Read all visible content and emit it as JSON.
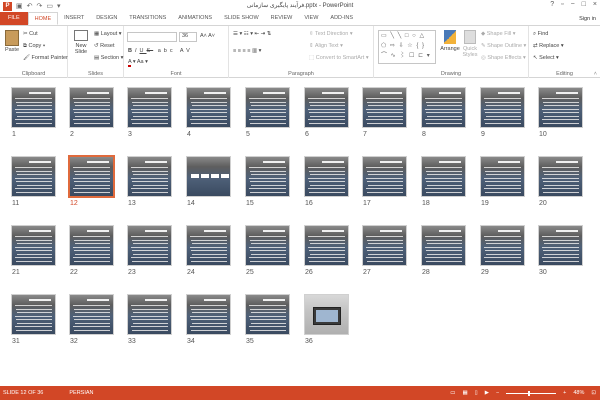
{
  "window": {
    "title": "فرآیند پایگیری سازمانی.pptx - PowerPoint",
    "app_icon": "P",
    "sign_in": "Sign in"
  },
  "tabs": [
    "FILE",
    "HOME",
    "INSERT",
    "DESIGN",
    "TRANSITIONS",
    "ANIMATIONS",
    "SLIDE SHOW",
    "REVIEW",
    "VIEW",
    "ADD-INS"
  ],
  "ribbon": {
    "clipboard": {
      "label": "Clipboard",
      "paste": "Paste",
      "cut": "Cut",
      "copy": "Copy",
      "format_painter": "Format Painter"
    },
    "slides": {
      "label": "Slides",
      "new_slide": "New Slide",
      "layout": "Layout",
      "reset": "Reset",
      "section": "Section"
    },
    "font": {
      "label": "Font",
      "size": "36",
      "bold": "B",
      "italic": "I",
      "underline": "U",
      "strike": "S",
      "abc": "abc",
      "av": "AV"
    },
    "paragraph": {
      "label": "Paragraph",
      "text_direction": "Text Direction",
      "align_text": "Align Text",
      "convert_smartart": "Convert to SmartArt"
    },
    "drawing": {
      "label": "Drawing",
      "arrange": "Arrange",
      "quick_styles": "Quick Styles",
      "shape_fill": "Shape Fill",
      "shape_outline": "Shape Outline",
      "shape_effects": "Shape Effects"
    },
    "editing": {
      "label": "Editing",
      "find": "Find",
      "replace": "Replace",
      "select": "Select"
    }
  },
  "slides": [
    "1",
    "2",
    "3",
    "4",
    "5",
    "6",
    "7",
    "8",
    "9",
    "10",
    "11",
    "12",
    "13",
    "14",
    "15",
    "16",
    "17",
    "18",
    "19",
    "20",
    "21",
    "22",
    "23",
    "24",
    "25",
    "26",
    "27",
    "28",
    "29",
    "30",
    "31",
    "32",
    "33",
    "34",
    "35",
    "36"
  ],
  "selected_slide": "12",
  "status": {
    "slide_info": "SLIDE 12 OF 36",
    "language": "PERSIAN",
    "zoom": "48%",
    "minus": "−",
    "plus": "+"
  }
}
